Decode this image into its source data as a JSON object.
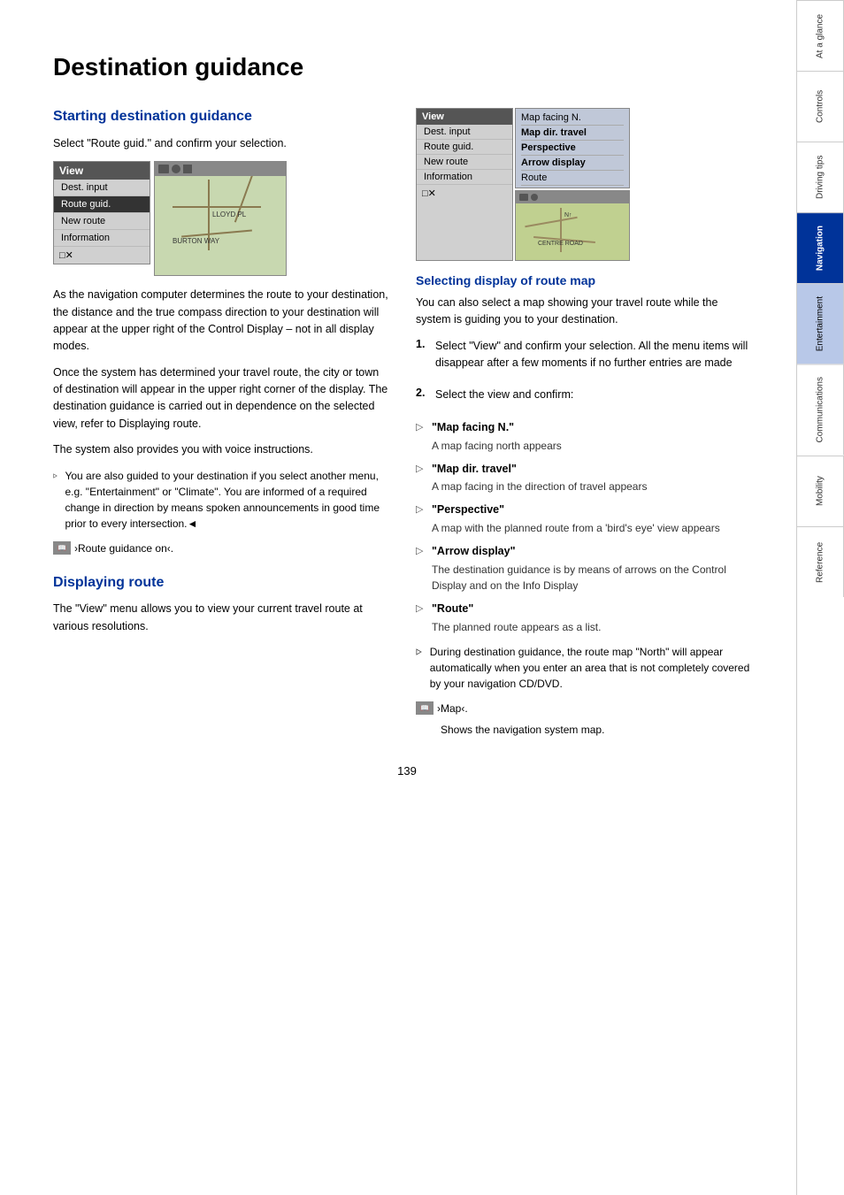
{
  "page": {
    "title": "Destination guidance",
    "page_number": "139"
  },
  "sections": {
    "starting_destination": {
      "heading": "Starting destination guidance",
      "para1": "Select \"Route guid.\" and confirm your selection.",
      "note1": "You are also guided to your destination if you select another menu, e.g. \"Entertainment\" or \"Climate\". You are informed of a required change in direction by means spoken announcements in good time prior to every intersection.◄",
      "ref1": "›Route guidance on‹."
    },
    "displaying_route": {
      "heading": "Displaying route",
      "para1": "The \"View\" menu allows you to view your current travel route at various resolutions."
    },
    "selecting_display": {
      "heading": "Selecting display of route map",
      "para1": "You can also select a map showing your travel route while the system is guiding you to your destination.",
      "step1_num": "1.",
      "step1_text": "Select \"View\" and confirm your selection. All the menu items will disappear after a few moments if no further entries are made",
      "step2_num": "2.",
      "step2_text": "Select the view and confirm:",
      "bullets": [
        {
          "title": "\"Map facing N.\"",
          "desc": "A map facing north appears"
        },
        {
          "title": "\"Map dir. travel\"",
          "desc": "A map facing in the direction of travel appears"
        },
        {
          "title": "\"Perspective\"",
          "desc": "A map with the planned route from a 'bird's eye' view appears"
        },
        {
          "title": "\"Arrow display\"",
          "desc": "The destination guidance is by means of arrows on the Control Display and on the Info Display"
        },
        {
          "title": "\"Route\"",
          "desc": "The planned route appears as a list."
        }
      ],
      "during_note": "During destination guidance, the route map \"North\" will appear automatically when you enter an area that is not completely covered by your navigation CD/DVD.",
      "ref2_label": "›Map‹.",
      "ref2_sub": "Shows the navigation system map."
    }
  },
  "left_menu": {
    "header": "View",
    "items": [
      "Dest. input",
      "Route guid.",
      "New route",
      "Information"
    ],
    "footer": "□✕",
    "selected": "Route guid."
  },
  "right_menu": {
    "header": "View",
    "items": [
      "Dest. input",
      "Route guid.",
      "New route",
      "Information"
    ],
    "footer": "□✕",
    "panel_items": [
      "Map facing N.",
      "Map dir. travel",
      "Perspective",
      "Arrow display",
      "Route"
    ]
  },
  "sidebar": {
    "tabs": [
      {
        "label": "At a glance",
        "active": false
      },
      {
        "label": "Controls",
        "active": false
      },
      {
        "label": "Driving tips",
        "active": false
      },
      {
        "label": "Navigation",
        "active": true
      },
      {
        "label": "Entertainment",
        "active": false
      },
      {
        "label": "Communications",
        "active": false
      },
      {
        "label": "Mobility",
        "active": false
      },
      {
        "label": "Reference",
        "active": false
      }
    ]
  }
}
